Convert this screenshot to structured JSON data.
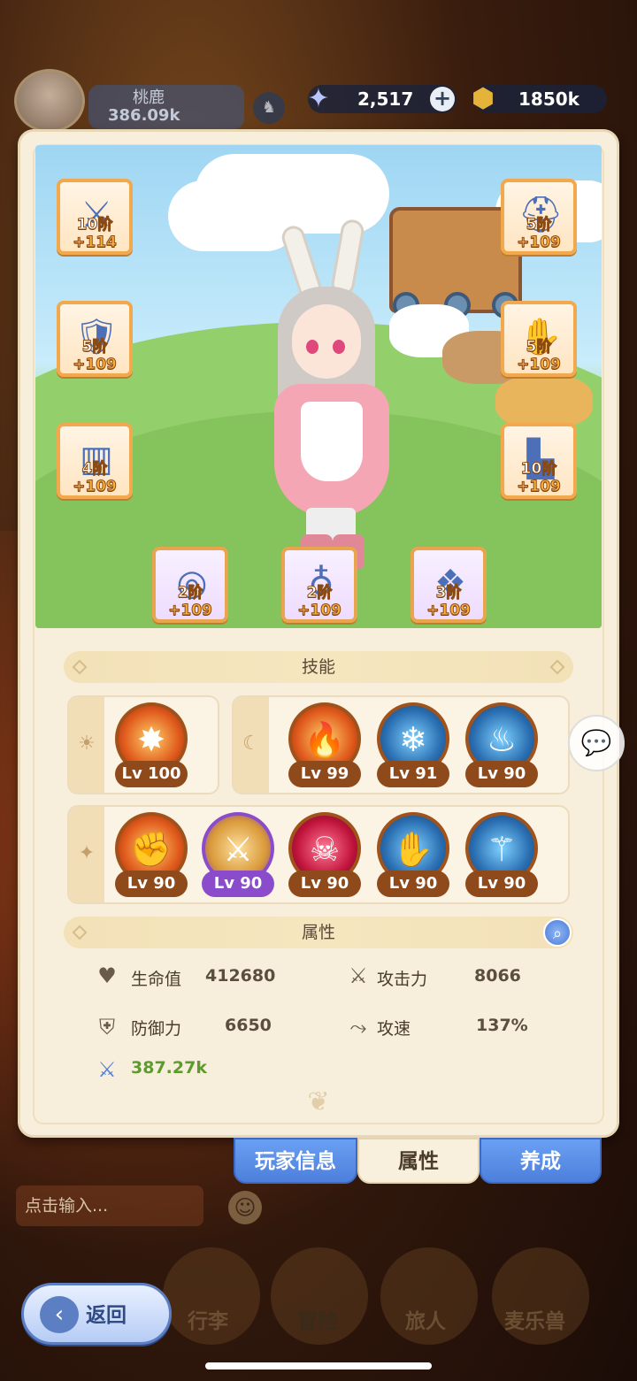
{
  "player": {
    "name": "桃鹿",
    "power": "386.09k"
  },
  "currency": {
    "gems": "2,517",
    "gold": "1850k"
  },
  "equipment": [
    {
      "tier": "10阶",
      "plus": "+114",
      "icon": "sword-icon"
    },
    {
      "tier": "5阶",
      "plus": "+109",
      "icon": "helmet-icon"
    },
    {
      "tier": "5阶",
      "plus": "+109",
      "icon": "armor-icon"
    },
    {
      "tier": "5阶",
      "plus": "+109",
      "icon": "gloves-icon"
    },
    {
      "tier": "4阶",
      "plus": "+109",
      "icon": "pants-icon"
    },
    {
      "tier": "10阶",
      "plus": "+109",
      "icon": "boots-icon"
    },
    {
      "tier": "2阶",
      "plus": "+109",
      "icon": "ring-icon"
    },
    {
      "tier": "2阶",
      "plus": "+109",
      "icon": "necklace-icon"
    },
    {
      "tier": "3阶",
      "plus": "+109",
      "icon": "amulet-icon"
    }
  ],
  "skills_header": "技能",
  "skill_groups": {
    "sun": {
      "icon": "sun-icon",
      "skills": [
        {
          "level": "Lv 100",
          "icon": "shield-burst-icon"
        }
      ]
    },
    "moon": {
      "icon": "moon-icon",
      "skills": [
        {
          "level": "Lv 99",
          "icon": "fire-slash-icon"
        },
        {
          "level": "Lv 91",
          "icon": "ice-guard-icon"
        },
        {
          "level": "Lv 90",
          "icon": "flame-spirit-icon"
        }
      ]
    },
    "star": {
      "icon": "star-icon",
      "skills": [
        {
          "level": "Lv 90",
          "icon": "fist-strike-icon"
        },
        {
          "level": "Lv 90",
          "icon": "sword-shield-icon"
        },
        {
          "level": "Lv 90",
          "icon": "shadow-flame-icon"
        },
        {
          "level": "Lv 90",
          "icon": "wind-palm-icon"
        },
        {
          "level": "Lv 90",
          "icon": "frost-blade-icon"
        }
      ]
    }
  },
  "attributes_header": "属性",
  "stats": {
    "hp_label": "生命值",
    "hp": "412680",
    "attack_label": "攻击力",
    "attack": "8066",
    "defense_label": "防御力",
    "defense": "6650",
    "speed_label": "攻速",
    "speed": "137%",
    "power": "387.27k"
  },
  "tabs": {
    "player_info": "玩家信息",
    "attributes": "属性",
    "develop": "养成"
  },
  "chat_placeholder": "点击输入...",
  "nav": {
    "luggage": "行李",
    "adventure": "冒险",
    "traveler": "旅人",
    "pet": "麦乐兽"
  },
  "back_label": "返回"
}
